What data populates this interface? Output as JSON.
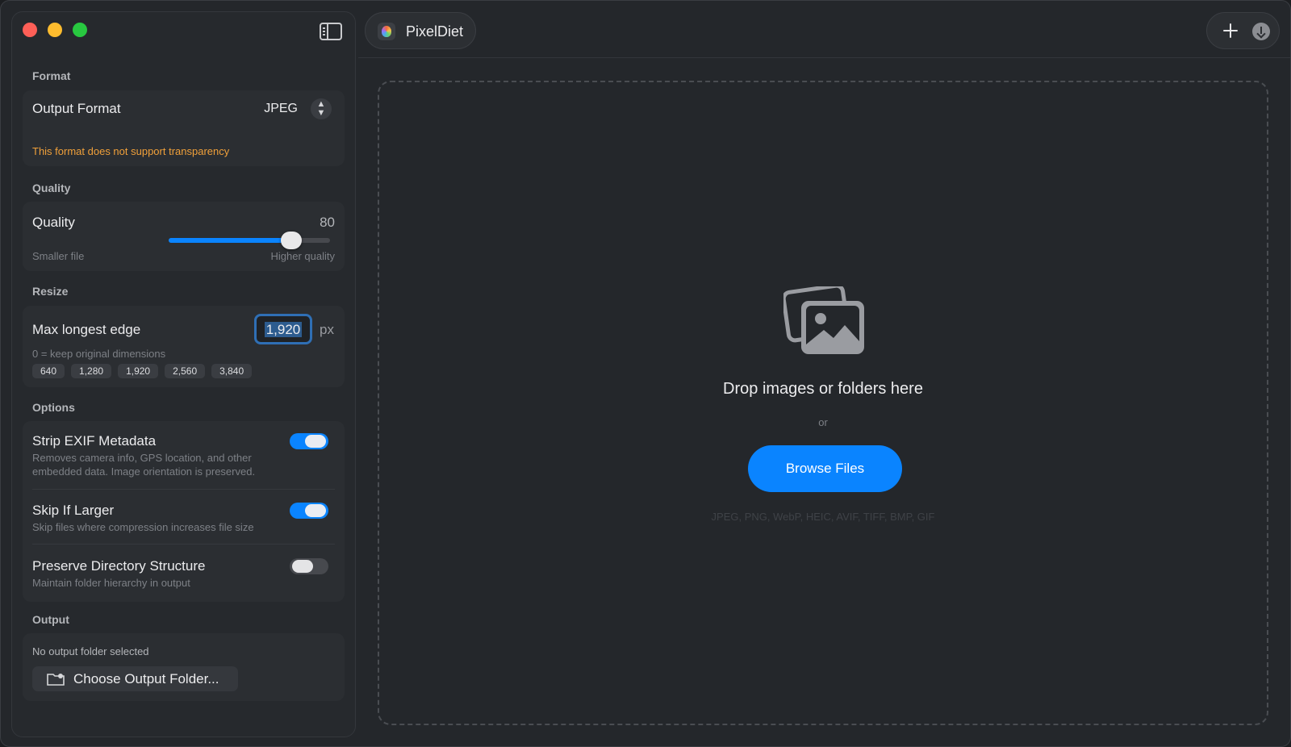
{
  "app": {
    "name": "PixelDiet"
  },
  "sidebar": {
    "format": {
      "section": "Format",
      "label": "Output Format",
      "value": "JPEG",
      "warning": "This format does not support transparency"
    },
    "quality": {
      "section": "Quality",
      "label": "Quality",
      "value": "80",
      "level_percent": 80,
      "min_label": "Smaller file",
      "max_label": "Higher quality"
    },
    "resize": {
      "section": "Resize",
      "label": "Max longest edge",
      "value": "1,920",
      "unit": "px",
      "hint": "0 = keep original dimensions",
      "presets": [
        "640",
        "1,280",
        "1,920",
        "2,560",
        "3,840"
      ]
    },
    "options": {
      "section": "Options",
      "items": [
        {
          "title": "Strip EXIF Metadata",
          "desc": "Removes camera info, GPS location, and other embedded data. Image orientation is preserved.",
          "on": true
        },
        {
          "title": "Skip If Larger",
          "desc": "Skip files where compression increases file size",
          "on": true
        },
        {
          "title": "Preserve Directory Structure",
          "desc": "Maintain folder hierarchy in output",
          "on": false
        }
      ]
    },
    "output": {
      "section": "Output",
      "status": "No output folder selected",
      "button": "Choose Output Folder..."
    }
  },
  "dropzone": {
    "title": "Drop images or folders here",
    "or": "or",
    "button": "Browse Files",
    "formats": "JPEG, PNG, WebP, HEIC, AVIF, TIFF, BMP, GIF"
  },
  "colors": {
    "accent": "#0a84ff",
    "warning": "#f0a03a"
  }
}
